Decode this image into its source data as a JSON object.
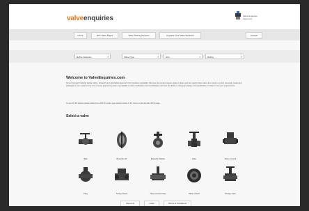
{
  "brand": {
    "part1": "valve",
    "part2": "enquiries"
  },
  "header_badge_text": "Valve Enquiries Approved",
  "nav": [
    {
      "label": "Home"
    },
    {
      "label": "New Valve Pages"
    },
    {
      "label": "Valve Testing Services"
    },
    {
      "label": "Upgrade Your Valve Solutions"
    },
    {
      "label": "Contact"
    }
  ],
  "filters": [
    {
      "label": "Refine Selection"
    },
    {
      "label": "Valve Type"
    },
    {
      "label": "Size"
    },
    {
      "label": "Rating"
    }
  ],
  "welcome": {
    "title": "Welcome to ValveEnquiries.com",
    "body": "Some (Compact Casting) supply valves, actuators and associated equipment from locations worldwide. We have the product ranges made of valves and can supply these valves from stock in a short timescale, tested and packaged to your requirements. Our in-house engineering team are available to valve modification and recertification and have the ability to change the design and specification of valves to suit your requirements.",
    "note": "To see the full options please select from either the valve type selector below or the menu on the left side of this page."
  },
  "select_title": "Select a valve",
  "valves": [
    {
      "label": "Ball",
      "icon": "ball-valve-icon"
    },
    {
      "label": "Butterfly HP",
      "icon": "butterfly-valve-icon"
    },
    {
      "label": "Butterfly Rubber",
      "icon": "butterfly-rubber-valve-icon"
    },
    {
      "label": "Gate",
      "icon": "gate-valve-icon"
    },
    {
      "label": "Piston Check",
      "icon": "piston-check-valve-icon"
    },
    {
      "label": "Plug",
      "icon": "plug-valve-icon"
    },
    {
      "label": "Swing Check",
      "icon": "swing-check-valve-icon"
    },
    {
      "label": "Thru Conduit Gate",
      "icon": "thru-conduit-gate-valve-icon"
    },
    {
      "label": "Wafer Check",
      "icon": "wafer-check-valve-icon"
    },
    {
      "label": "Wedge Gate",
      "icon": "wedge-gate-valve-icon"
    }
  ],
  "footer": [
    {
      "label": "About Us"
    },
    {
      "label": "Links"
    },
    {
      "label": "Terms & Conditions"
    }
  ],
  "colors": {
    "brand_orange": "#e8731c",
    "valve_dark": "#3a3a3a"
  }
}
